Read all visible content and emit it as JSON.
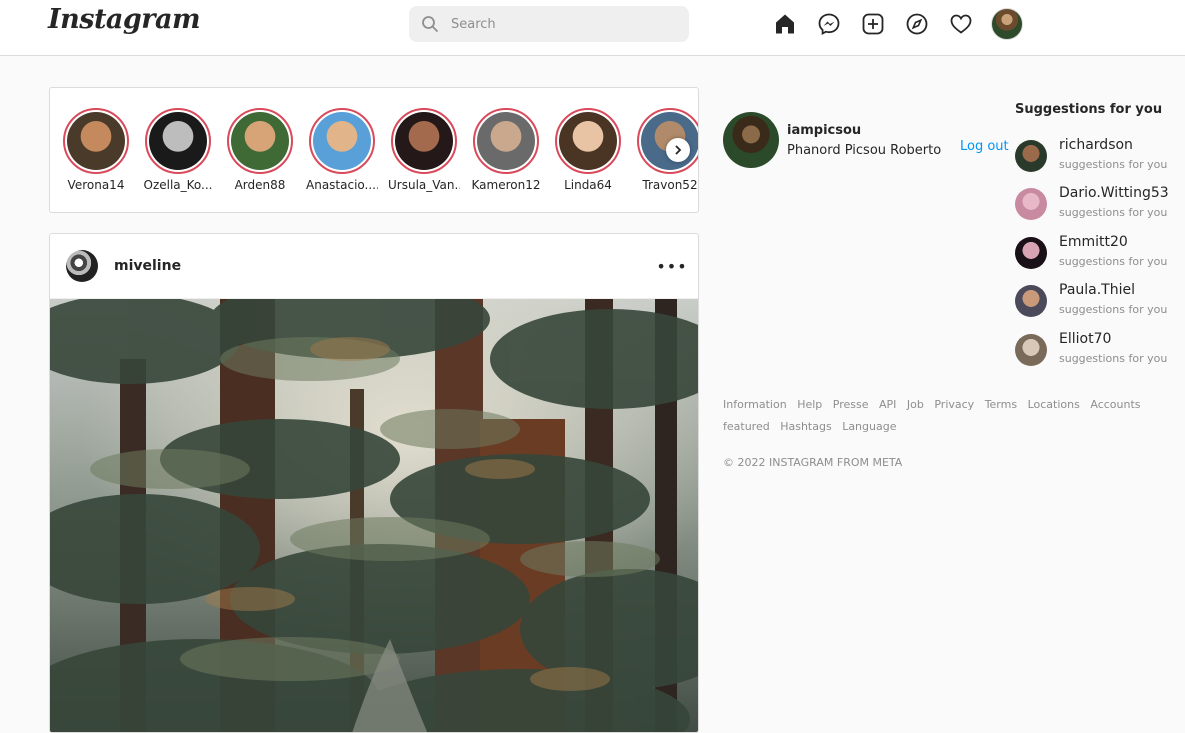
{
  "header": {
    "logo": "Instagram",
    "search_placeholder": "Search",
    "nav_icons": [
      "home-icon",
      "messenger-icon",
      "new-post-icon",
      "explore-icon",
      "activity-heart-icon",
      "profile-avatar"
    ]
  },
  "stories": [
    {
      "username": "Verona14",
      "colors": [
        "#c48a5e",
        "#4a3a2a"
      ]
    },
    {
      "username": "Ozella_Ko...",
      "colors": [
        "#bdbdbd",
        "#1a1a1a"
      ]
    },
    {
      "username": "Arden88",
      "colors": [
        "#d7a478",
        "#3f6a35"
      ]
    },
    {
      "username": "Anastacio....",
      "colors": [
        "#e2b48a",
        "#5aa0d8"
      ]
    },
    {
      "username": "Ursula_Van...",
      "colors": [
        "#a36a4e",
        "#241818"
      ]
    },
    {
      "username": "Kameron12",
      "colors": [
        "#c9a88e",
        "#6a6a6a"
      ]
    },
    {
      "username": "Linda64",
      "colors": [
        "#e8c4a4",
        "#4a3424"
      ]
    },
    {
      "username": "Travon52",
      "colors": [
        "#b08a6a",
        "#4a6a8a"
      ]
    }
  ],
  "post": {
    "username": "miveline",
    "more_label": "•••"
  },
  "profile": {
    "username": "iampicsou",
    "full_name": "Phanord Picsou Roberto",
    "logout_label": "Log out"
  },
  "suggestions": {
    "title": "Suggestions for you",
    "items": [
      {
        "username": "richardson",
        "subtitle": "suggestions for you",
        "colors": [
          "#9a6a4a",
          "#2a3a2a"
        ]
      },
      {
        "username": "Dario.Witting53",
        "subtitle": "suggestions for you",
        "colors": [
          "#e8b8c8",
          "#c88aa0"
        ]
      },
      {
        "username": "Emmitt20",
        "subtitle": "suggestions for you",
        "colors": [
          "#d8a4b4",
          "#1a1018"
        ]
      },
      {
        "username": "Paula.Thiel",
        "subtitle": "suggestions for you",
        "colors": [
          "#c89a7a",
          "#4a4a5a"
        ]
      },
      {
        "username": "Elliot70",
        "subtitle": "suggestions for you",
        "colors": [
          "#d8c8b8",
          "#7a6a5a"
        ]
      }
    ]
  },
  "footer": {
    "links": [
      "Information",
      "Help",
      "Presse",
      "API",
      "Job",
      "Privacy",
      "Terms",
      "Locations",
      "Accounts",
      "featured",
      "Hashtags",
      "Language"
    ],
    "copyright": "© 2022 INSTAGRAM FROM META"
  }
}
